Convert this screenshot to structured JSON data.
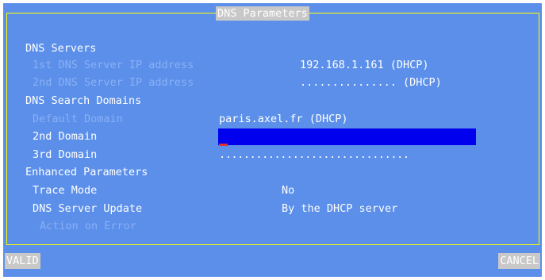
{
  "dialog": {
    "title": "DNS Parameters"
  },
  "dns_servers": {
    "heading": "DNS Servers",
    "first_label": "1st DNS Server IP address",
    "first_value": "192.168.1.161 (DHCP)",
    "second_label": "2nd DNS Server IP address",
    "second_value": "............... (DHCP)"
  },
  "search_domains": {
    "heading": "DNS Search Domains",
    "default_label": "Default Domain",
    "default_value": "paris.axel.fr (DHCP)",
    "second_label": "2nd Domain",
    "second_value": "",
    "third_label": "3rd Domain",
    "third_value": "..............................."
  },
  "enhanced": {
    "heading": "Enhanced Parameters",
    "trace_label": "Trace Mode",
    "trace_value": "No",
    "update_label": "DNS Server Update",
    "update_value": "By the DHCP server",
    "action_label": "Action on Error"
  },
  "buttons": {
    "valid": "VALID",
    "cancel": "CANCEL"
  },
  "colors": {
    "background": "#5b8fea",
    "frame": "#ffff00",
    "input_active": "#0000ee",
    "disabled_text": "#8ab0f5"
  }
}
